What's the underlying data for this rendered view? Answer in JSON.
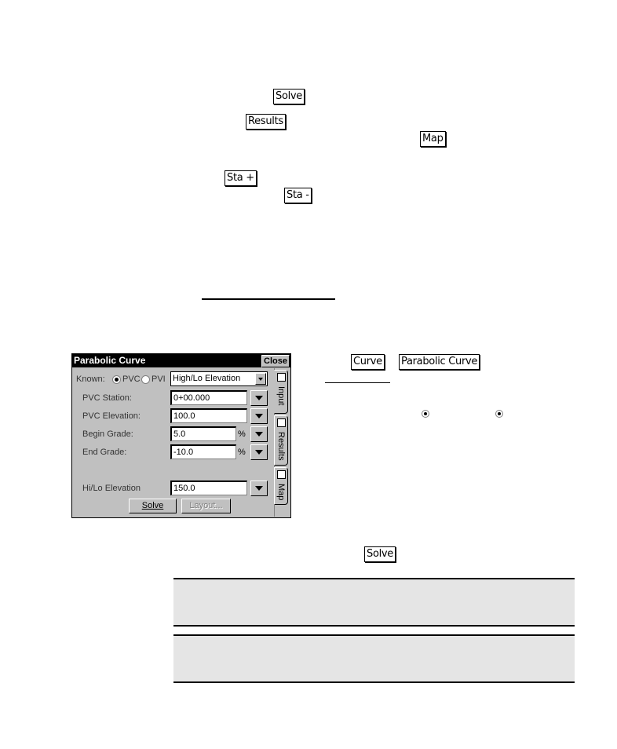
{
  "inline_buttons": {
    "solve_1": "Solve",
    "results": "Results",
    "map": "Map",
    "sta_plus": "Sta +",
    "sta_minus": "Sta -",
    "curve": "Curve",
    "parabolic_curve": "Parabolic Curve",
    "solve_2": "Solve"
  },
  "dialog": {
    "title": "Parabolic Curve",
    "close_label": "Close",
    "known_label": "Known:",
    "radio_pvc": "PVC",
    "radio_pvi": "PVI",
    "known_selected": "PVC",
    "mode_dropdown": "High/Lo Elevation",
    "fields": [
      {
        "label": "PVC Station:",
        "value": "0+00.000",
        "unit": ""
      },
      {
        "label": "PVC Elevation:",
        "value": "100.0",
        "unit": ""
      },
      {
        "label": "Begin Grade:",
        "value": "5.0",
        "unit": "%"
      },
      {
        "label": "End Grade:",
        "value": "-10.0",
        "unit": "%"
      },
      {
        "label": "Hi/Lo Elevation",
        "value": "150.0",
        "unit": ""
      }
    ],
    "solve_button": "Solve",
    "layout_button": "Layout...",
    "tabs": [
      {
        "label": "Input",
        "icon": "input-icon"
      },
      {
        "label": "Results",
        "icon": "results-icon"
      },
      {
        "label": "Map",
        "icon": "map-icon"
      }
    ]
  }
}
